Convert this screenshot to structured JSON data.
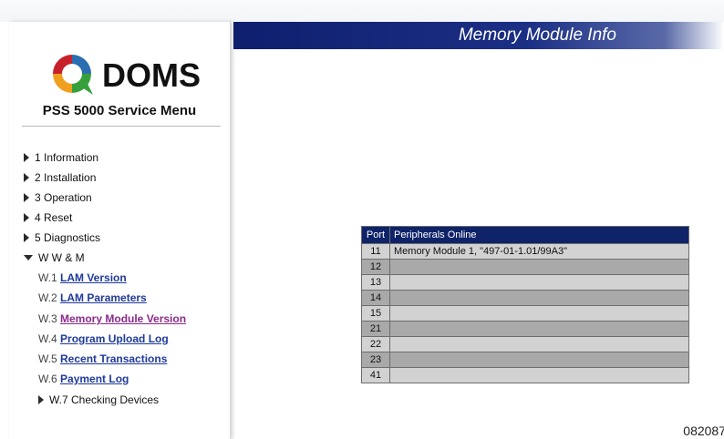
{
  "header": {
    "title": "Memory Module Info"
  },
  "brand": {
    "name": "DOMS",
    "colors": [
      "#c8202a",
      "#2a6db0",
      "#36a03c",
      "#f0a020"
    ]
  },
  "menu": {
    "title": "PSS 5000 Service Menu",
    "items": [
      {
        "label": "1 Information"
      },
      {
        "label": "2 Installation"
      },
      {
        "label": "3 Operation"
      },
      {
        "label": "4 Reset"
      },
      {
        "label": "5 Diagnostics"
      },
      {
        "label": "W W & M"
      }
    ],
    "sub_items": [
      {
        "prefix": "W.1",
        "label": "LAM Version"
      },
      {
        "prefix": "W.2",
        "label": "LAM Parameters"
      },
      {
        "prefix": "W.3",
        "label": "Memory Module Version"
      },
      {
        "prefix": "W.4",
        "label": "Program Upload Log"
      },
      {
        "prefix": "W.5",
        "label": "Recent Transactions"
      },
      {
        "prefix": "W.6",
        "label": "Payment Log"
      },
      {
        "prefix": "",
        "label": "W.7 Checking Devices"
      }
    ]
  },
  "table": {
    "headers": [
      "Port",
      "Peripherals Online"
    ],
    "rows": [
      {
        "port": "11",
        "value": "Memory Module 1, \"497-01-1.01/99A3\""
      },
      {
        "port": "12",
        "value": ""
      },
      {
        "port": "13",
        "value": ""
      },
      {
        "port": "14",
        "value": ""
      },
      {
        "port": "15",
        "value": ""
      },
      {
        "port": "21",
        "value": ""
      },
      {
        "port": "22",
        "value": ""
      },
      {
        "port": "23",
        "value": ""
      },
      {
        "port": "41",
        "value": ""
      }
    ]
  },
  "footer": {
    "code": "082087"
  }
}
